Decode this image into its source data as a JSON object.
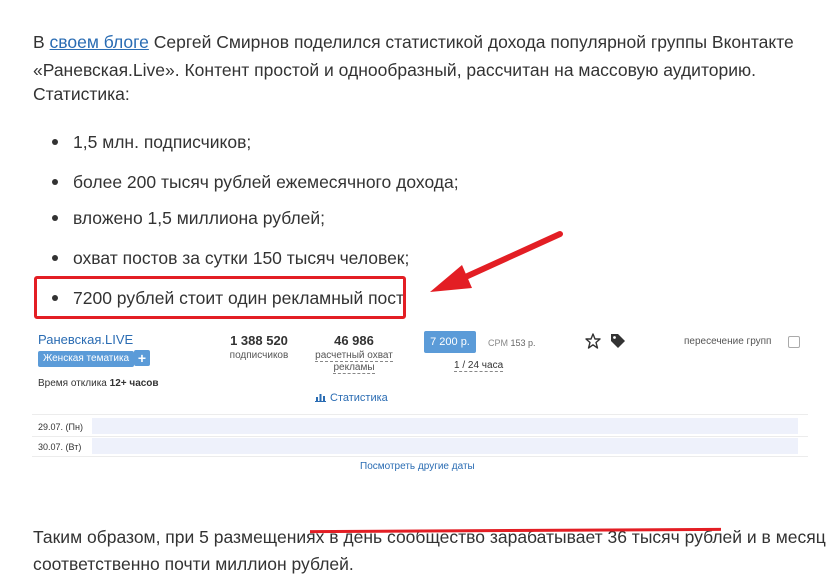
{
  "intro": {
    "prefix": "В ",
    "link": "своем блоге",
    "rest": " Сергей Смирнов поделился статистикой дохода популярной группы Вконтакте «Раневская.Live». Контент простой и однообразный, рассчитан на массовую аудиторию."
  },
  "stats_heading": "Статистика:",
  "bullets": [
    "1,5 млн. подписчиков;",
    "более 200 тысяч рублей ежемесячного дохода;",
    "вложено 1,5 миллиона рублей;",
    "охват постов за сутки 150 тысяч человек;",
    "7200 рублей стоит один рекламный пост."
  ],
  "widget": {
    "group_name": "Раневская.LIVE",
    "tag": "Женская тематика",
    "plus": "+",
    "response_label": "Время отклика ",
    "response_value": "12+ часов",
    "subscribers_value": "1 388 520",
    "subscribers_label": "подписчиков",
    "reach_value": "46 986",
    "reach_label_1": "расчетный охват",
    "reach_label_2": "рекламы",
    "price": "7 200 р.",
    "cpm_label": "CPM",
    "cpm_value": "153 р.",
    "slot": "1 / 24 часа",
    "crossing": "пересечение групп",
    "stats_link": "Статистика",
    "dates": [
      "29.07. (Пн)",
      "30.07. (Вт)"
    ],
    "other_dates": "Посмотреть другие даты",
    "colors": {
      "accent": "#5b9bd8",
      "link": "#2a6cb3",
      "date_bar": "#eef1fb"
    }
  },
  "conclusion": "Таким образом, при 5 размещениях в день сообщество зарабатывает 36 тысяч рублей и в месяц соответственно почти миллион рублей.",
  "annotation_color": "#e31e24"
}
